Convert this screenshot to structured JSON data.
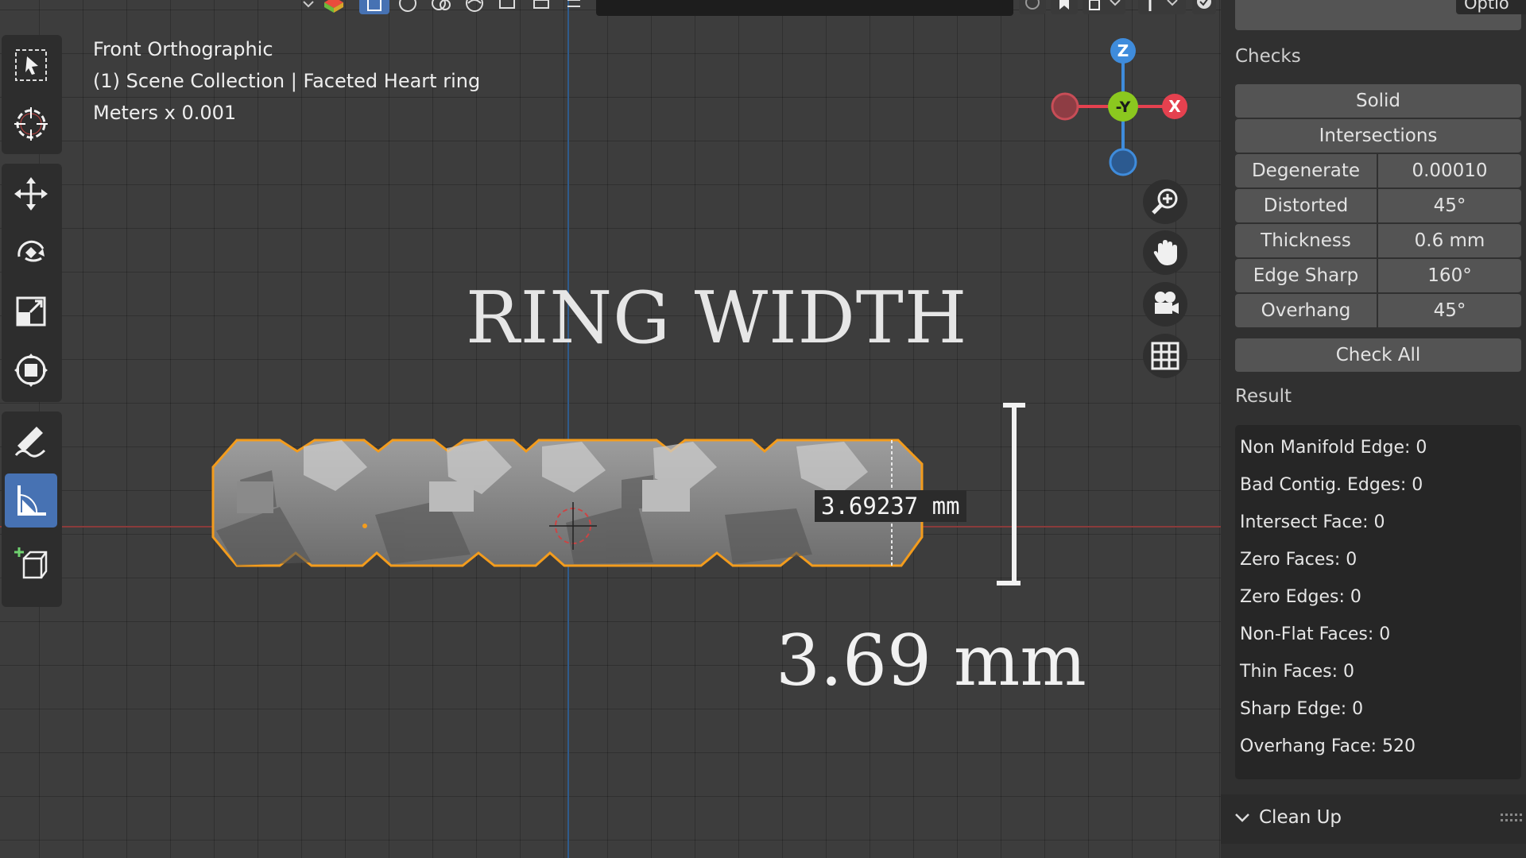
{
  "viewport": {
    "view_name": "Front Orthographic",
    "collection": "(1) Scene Collection | Faceted Heart ring",
    "units": "Meters x 0.001",
    "headline": "RING WIDTH",
    "measure_label": "3.69237 mm",
    "measure_big": "3.69 mm",
    "gizmo": {
      "z_label": "Z",
      "y_label": "-Y",
      "x_label": "X"
    },
    "colors": {
      "x_axis": "#e5414f",
      "y_axis": "#8bc81f",
      "z_axis": "#3f8cdc",
      "selection": "#f39c1d",
      "active_tool": "#4772b3"
    }
  },
  "header": {
    "options_label": "Optio"
  },
  "toolbar": {
    "tools": [
      "select-box-icon",
      "cursor-icon",
      "move-icon",
      "rotate-icon",
      "scale-icon",
      "transform-icon",
      "annotate-icon",
      "measure-icon",
      "add-cube-icon"
    ],
    "active": "measure-icon"
  },
  "nav_buttons": [
    "zoom-icon",
    "pan-hand-icon",
    "camera-icon",
    "grid-icon"
  ],
  "panel": {
    "checks_title": "Checks",
    "solid": "Solid",
    "intersections": "Intersections",
    "rows": [
      {
        "label": "Degenerate",
        "value": "0.00010"
      },
      {
        "label": "Distorted",
        "value": "45°"
      },
      {
        "label": "Thickness",
        "value": "0.6 mm"
      },
      {
        "label": "Edge Sharp",
        "value": "160°"
      },
      {
        "label": "Overhang",
        "value": "45°"
      }
    ],
    "check_all": "Check All",
    "result_title": "Result",
    "results": [
      "Non Manifold Edge: 0",
      "Bad Contig. Edges: 0",
      "Intersect Face: 0",
      "Zero Faces: 0",
      "Zero Edges: 0",
      "Non-Flat Faces: 0",
      "Thin Faces: 0",
      "Sharp Edge: 0",
      "Overhang Face: 520"
    ],
    "cleanup_label": "Clean Up"
  }
}
